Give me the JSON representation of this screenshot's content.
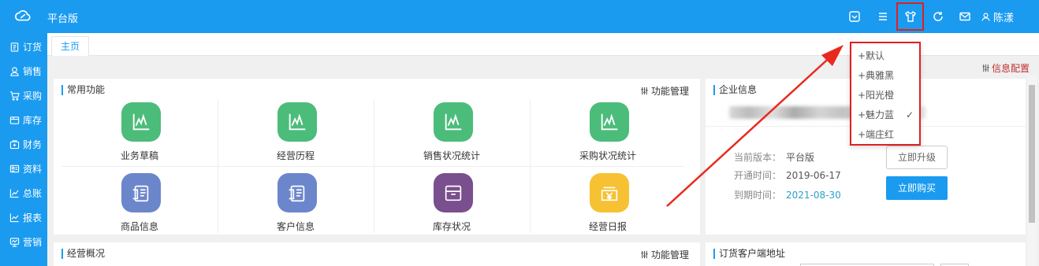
{
  "app": {
    "title": "平台版",
    "user": "陈漾"
  },
  "sidebar": {
    "items": [
      {
        "label": "订货",
        "icon": "clipboard-icon"
      },
      {
        "label": "销售",
        "icon": "person-icon"
      },
      {
        "label": "采购",
        "icon": "cart-icon"
      },
      {
        "label": "库存",
        "icon": "box-icon"
      },
      {
        "label": "财务",
        "icon": "wallet-icon"
      },
      {
        "label": "资料",
        "icon": "card-icon"
      },
      {
        "label": "总账",
        "icon": "chart-icon"
      },
      {
        "label": "报表",
        "icon": "report-icon"
      },
      {
        "label": "营销",
        "icon": "screen-icon"
      }
    ]
  },
  "tabs": [
    {
      "label": "主页"
    }
  ],
  "info_config": "信息配置",
  "common": {
    "title": "常用功能",
    "action": "功能管理",
    "items": [
      {
        "label": "业务草稿",
        "icon": "chart-line-icon",
        "color": "#4cbc7a"
      },
      {
        "label": "经营历程",
        "icon": "chart-line-icon",
        "color": "#4cbc7a"
      },
      {
        "label": "销售状况统计",
        "icon": "chart-line-icon",
        "color": "#4cbc7a"
      },
      {
        "label": "采购状况统计",
        "icon": "chart-line-icon",
        "color": "#4cbc7a"
      },
      {
        "label": "商品信息",
        "icon": "id-card-icon",
        "color": "#6c86cc"
      },
      {
        "label": "客户信息",
        "icon": "id-card-icon",
        "color": "#6c86cc"
      },
      {
        "label": "库存状况",
        "icon": "storage-box-icon",
        "color": "#7a4f8e"
      },
      {
        "label": "经营日报",
        "icon": "yen-box-icon",
        "color": "#f6c233"
      }
    ]
  },
  "business": {
    "title": "经营概况",
    "action": "功能管理"
  },
  "company": {
    "title": "企业信息",
    "version_label": "当前版本：",
    "version_value": "平台版",
    "open_label": "开通时间：",
    "open_value": "2019-06-17",
    "expire_label": "到期时间：",
    "expire_value": "2021-08-30",
    "upgrade_label": "立即升级",
    "buy_label": "立即购买"
  },
  "order_address": {
    "title": "订货客户端地址"
  },
  "theme_menu": {
    "items": [
      {
        "label": "+默认",
        "checked": false
      },
      {
        "label": "+典雅黑",
        "checked": false
      },
      {
        "label": "+阳光橙",
        "checked": false
      },
      {
        "label": "+魅力蓝",
        "checked": true
      },
      {
        "label": "+端庄红",
        "checked": false
      }
    ],
    "check": "✓"
  },
  "colors": {
    "primary": "#1a9bf0",
    "highlight": "#e02020",
    "config": "#c03030"
  }
}
